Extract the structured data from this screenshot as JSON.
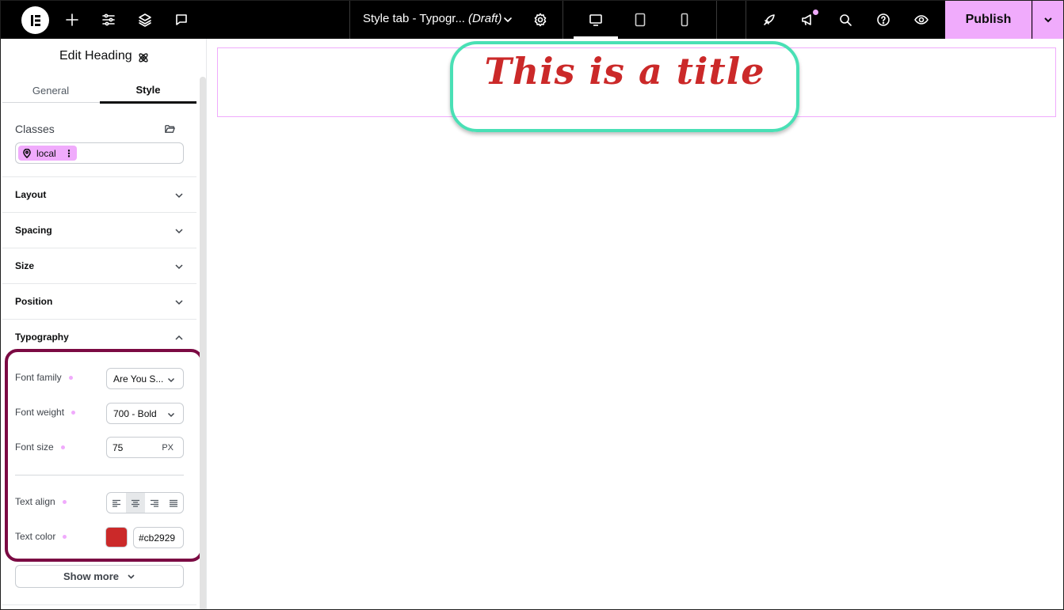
{
  "topbar": {
    "doc_title": "Style tab - Typogr...",
    "doc_status": "(Draft)",
    "publish_label": "Publish"
  },
  "panel": {
    "title": "Edit Heading",
    "tabs": [
      {
        "label": "General",
        "active": false
      },
      {
        "label": "Style",
        "active": true
      }
    ],
    "classes_label": "Classes",
    "class_chip": "local",
    "sections": [
      {
        "label": "Layout",
        "expanded": false
      },
      {
        "label": "Spacing",
        "expanded": false
      },
      {
        "label": "Size",
        "expanded": false
      },
      {
        "label": "Position",
        "expanded": false
      },
      {
        "label": "Typography",
        "expanded": true
      }
    ],
    "typography": {
      "font_family_label": "Font family",
      "font_family_value": "Are You S...",
      "font_weight_label": "Font weight",
      "font_weight_value": "700 - Bold",
      "font_size_label": "Font size",
      "font_size_value": "75",
      "font_size_unit": "PX",
      "text_align_label": "Text align",
      "text_align_selected": "center",
      "text_color_label": "Text color",
      "text_color_value": "#cb2929"
    },
    "show_more_label": "Show more"
  },
  "canvas": {
    "heading_text": "This is a title"
  },
  "colors": {
    "accent": "#f0abfc",
    "title_color": "#cb2929",
    "highlight_teal": "#49e0b5",
    "highlight_maroon": "#7b0a43"
  }
}
